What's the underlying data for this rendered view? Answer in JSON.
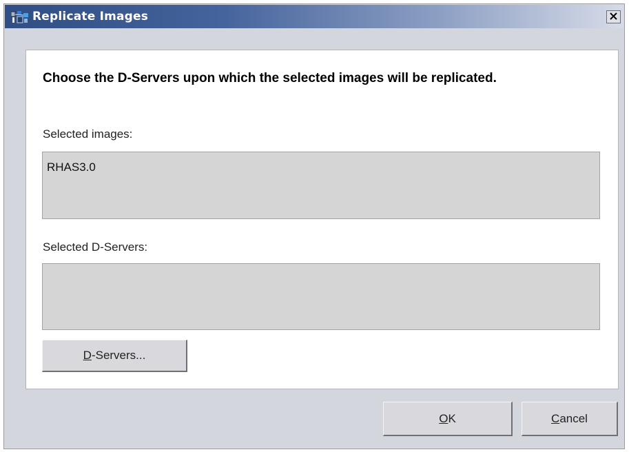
{
  "window": {
    "title": "Replicate Images",
    "close_label": "×"
  },
  "instruction": "Choose the D-Servers upon which the selected images will be replicated.",
  "selected_images": {
    "label": "Selected images:",
    "items": [
      "RHAS3.0"
    ]
  },
  "selected_servers": {
    "label": "Selected D-Servers:",
    "items": []
  },
  "buttons": {
    "servers": {
      "mnemonic": "D",
      "rest": "-Servers..."
    },
    "ok": {
      "mnemonic": "O",
      "rest": "K"
    },
    "cancel": {
      "mnemonic": "C",
      "rest": "ancel"
    }
  },
  "colors": {
    "title_gradient_start": "#2f4e83",
    "title_gradient_end": "#d7dbe8",
    "dialog_background": "#d4d6de",
    "listbox_background": "#d5d5d5"
  },
  "icons": {
    "title": "app-network-icon",
    "close": "close-icon"
  }
}
